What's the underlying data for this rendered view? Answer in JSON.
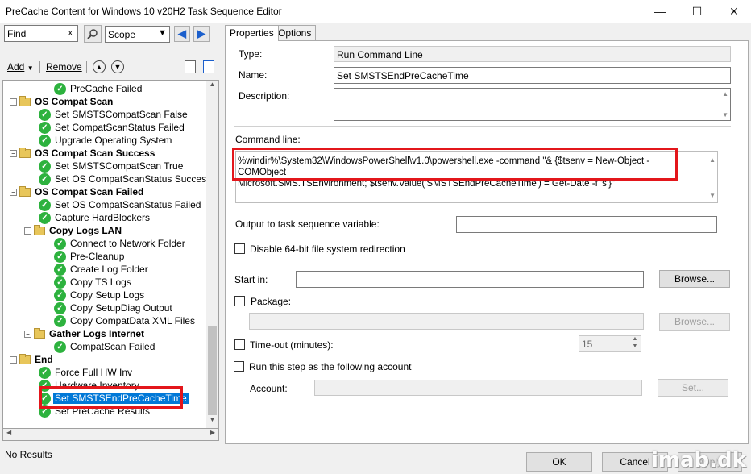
{
  "window": {
    "title": "PreCache Content for Windows 10 v20H2 Task Sequence Editor",
    "minimize_glyph": "—",
    "maximize_glyph": "☐",
    "close_glyph": "✕"
  },
  "left_toolbar": {
    "find_value": "Find",
    "find_clear": "x",
    "scope_value": "Scope",
    "add_label": "Add",
    "remove_label": "Remove"
  },
  "tree": {
    "items": [
      {
        "label": "PreCache Failed",
        "kind": "step"
      },
      {
        "label": "OS Compat Scan",
        "kind": "group"
      },
      {
        "label": "Set SMSTSCompatScan False",
        "kind": "step"
      },
      {
        "label": "Set CompatScanStatus Failed",
        "kind": "step"
      },
      {
        "label": "Upgrade Operating System",
        "kind": "step"
      },
      {
        "label": "OS Compat Scan Success",
        "kind": "group"
      },
      {
        "label": "Set SMSTSCompatScan True",
        "kind": "step"
      },
      {
        "label": "Set OS CompatScanStatus Success",
        "kind": "step"
      },
      {
        "label": "OS Compat Scan Failed",
        "kind": "group"
      },
      {
        "label": "Set OS CompatScanStatus Failed",
        "kind": "step"
      },
      {
        "label": "Capture HardBlockers",
        "kind": "step"
      },
      {
        "label": "Copy Logs LAN",
        "kind": "group"
      },
      {
        "label": "Connect to Network Folder",
        "kind": "step"
      },
      {
        "label": "Pre-Cleanup",
        "kind": "step"
      },
      {
        "label": "Create Log Folder",
        "kind": "step"
      },
      {
        "label": "Copy TS Logs",
        "kind": "step"
      },
      {
        "label": "Copy Setup Logs",
        "kind": "step"
      },
      {
        "label": "Copy SetupDiag Output",
        "kind": "step"
      },
      {
        "label": "Copy CompatData XML Files",
        "kind": "step"
      },
      {
        "label": "Gather Logs Internet",
        "kind": "group"
      },
      {
        "label": "CompatScan Failed",
        "kind": "step"
      },
      {
        "label": "End",
        "kind": "group"
      },
      {
        "label": "Force Full HW Inv",
        "kind": "step"
      },
      {
        "label": "Hardware Inventory",
        "kind": "step"
      },
      {
        "label": "Set SMSTSEndPreCacheTime",
        "kind": "step",
        "selected": true
      },
      {
        "label": "Set PreCache Results",
        "kind": "step"
      }
    ]
  },
  "status_bar": "No Results",
  "tabs": [
    "Properties",
    "Options"
  ],
  "properties": {
    "type_label": "Type:",
    "type_value": "Run Command Line",
    "name_label": "Name:",
    "name_value": "Set SMSTSEndPreCacheTime",
    "description_label": "Description:",
    "description_value": "",
    "command_label": "Command line:",
    "command_line_1": "%windir%\\System32\\WindowsPowerShell\\v1.0\\powershell.exe -command \"& {$tsenv = New-Object -COMObject",
    "command_line_2": "Microsoft.SMS.TSEnvironment; $tsenv.Value('SMSTSEndPreCacheTime') = Get-Date -f 's'}\"",
    "output_var_label": "Output to task sequence variable:",
    "output_var_value": "",
    "disable64_label": "Disable 64-bit file system redirection",
    "start_in_label": "Start in:",
    "start_in_value": "",
    "browse_label": "Browse...",
    "package_label": "Package:",
    "package_value": "",
    "timeout_label": "Time-out (minutes):",
    "timeout_value": "15",
    "run_as_label": "Run this step as the following account",
    "account_label": "Account:",
    "account_value": "",
    "set_label": "Set..."
  },
  "bottom": {
    "ok_label": "OK",
    "cancel_label": "Cancel",
    "apply_label": "Apply",
    "watermark": "imab.dk"
  },
  "colors": {
    "highlight_box": "#e3161b",
    "selection": "#0078d7",
    "step_check": "#2db23e",
    "folder": "#e8c65a"
  }
}
